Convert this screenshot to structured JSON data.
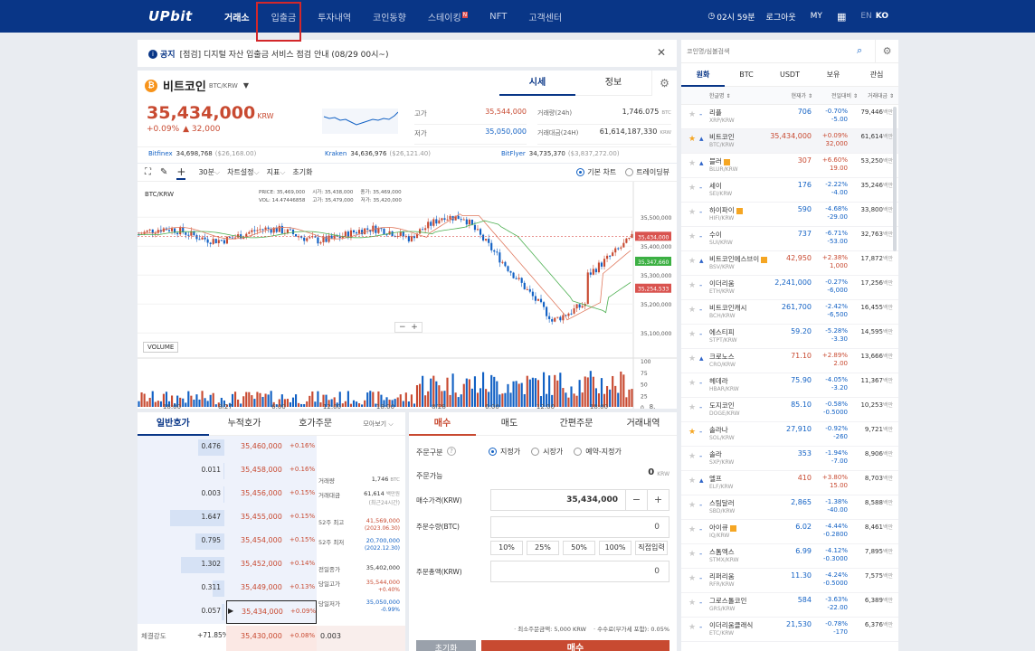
{
  "nav": {
    "logo": "UPbit",
    "menu": [
      {
        "label": "거래소",
        "active": true
      },
      {
        "label": "입출금",
        "active": false
      },
      {
        "label": "투자내역",
        "active": false
      },
      {
        "label": "코인동향",
        "active": false
      },
      {
        "label": "스테이킹",
        "active": false,
        "badge": "N"
      },
      {
        "label": "NFT",
        "active": false
      },
      {
        "label": "고객센터",
        "active": false
      }
    ],
    "timer": "02시 59분",
    "logout": "로그아웃",
    "my": "MY",
    "lang_en": "EN",
    "lang_ko": "KO"
  },
  "notice": {
    "tag": "공지",
    "text": "[점검] 디지털 자산 입출금 서비스 점검 안내 (08/29 00시~)"
  },
  "coin": {
    "name": "비트코인",
    "pair": "BTC/KRW",
    "price": "35,434,000",
    "unit": "KRW",
    "change_pct": "+0.09%",
    "change_amt": "▲ 32,000",
    "tab_chart": "시세",
    "tab_info": "정보",
    "stats": [
      {
        "label": "고가",
        "value": "35,544,000",
        "cls": "up"
      },
      {
        "label": "저가",
        "value": "35,050,000",
        "cls": "dn"
      }
    ],
    "stats2": [
      {
        "label": "거래량(24h)",
        "value": "1,746.075",
        "unit": "BTC"
      },
      {
        "label": "거래대금(24H)",
        "value": "61,614,187,330",
        "unit": "KRW"
      }
    ],
    "exchanges": [
      {
        "name": "Bitfinex",
        "price": "34,698,768",
        "usd": "($26,168.00)"
      },
      {
        "name": "Kraken",
        "price": "34,636,976",
        "usd": "($26,121.40)"
      },
      {
        "name": "BitFlyer",
        "price": "34,735,370",
        "usd": "($3,837,272.00)"
      }
    ]
  },
  "chart_toolbar": {
    "interval": "30분",
    "settings": "차트설정",
    "indicators": "지표",
    "reset": "초기화",
    "basic": "기본 차트",
    "tv": "트레이딩뷰"
  },
  "chart_data": {
    "type": "candlestick",
    "title": "BTC/KRW",
    "legend": {
      "price_label": "PRICE:",
      "price": "35,469,000",
      "vol_label": "VOL:",
      "vol": "14.47446858",
      "open_label": "시가:",
      "open": "35,438,000",
      "high_label": "고가:",
      "high": "35,479,000",
      "close_label": "종가:",
      "close": "35,469,000",
      "low_label": "저가:",
      "low": "35,420,000"
    },
    "y_ticks": [
      "35,500,000",
      "35,400,000",
      "35,300,000",
      "35,200,000",
      "35,100,000"
    ],
    "price_tags": [
      {
        "value": "35,434,000",
        "color": "#d9534f"
      },
      {
        "value": "35,347,660",
        "color": "#3cb043"
      },
      {
        "value": "35,254,533",
        "color": "#d9534f"
      }
    ],
    "x_ticks": [
      "18:00",
      "8/27",
      "6:00",
      "12:00",
      "18:00",
      "8/28",
      "6:00",
      "12:00",
      "18:00",
      "8."
    ],
    "volume_label": "VOLUME",
    "volume_ticks": [
      "100",
      "75",
      "50",
      "25",
      "0"
    ]
  },
  "orderbook": {
    "tabs": [
      "일반호가",
      "누적호가",
      "호가주문"
    ],
    "view": "모아보기",
    "rows": [
      {
        "qty": "0.476",
        "price": "35,460,000",
        "pct": "+0.16%",
        "bar": 0.3
      },
      {
        "qty": "0.011",
        "price": "35,458,000",
        "pct": "+0.16%",
        "bar": 0.01
      },
      {
        "qty": "0.003",
        "price": "35,456,000",
        "pct": "+0.15%",
        "bar": 0.01
      },
      {
        "qty": "1.647",
        "price": "35,455,000",
        "pct": "+0.15%",
        "bar": 0.62
      },
      {
        "qty": "0.795",
        "price": "35,454,000",
        "pct": "+0.15%",
        "bar": 0.33
      },
      {
        "qty": "1.302",
        "price": "35,452,000",
        "pct": "+0.14%",
        "bar": 0.5
      },
      {
        "qty": "0.311",
        "price": "35,449,000",
        "pct": "+0.13%",
        "bar": 0.14
      },
      {
        "qty": "0.057",
        "price": "35,434,000",
        "pct": "+0.09%",
        "bar": 0.03
      }
    ],
    "info": [
      {
        "label": "거래량",
        "value": "1,746",
        "unit": "BTC"
      },
      {
        "label": "거래대금",
        "value": "61,614",
        "unit": "백만원",
        "sub": "(최근24시간)"
      },
      {
        "label": "52주 최고",
        "value": "41,569,000",
        "sub": "(2023.06.30)",
        "cls": "up"
      },
      {
        "label": "52주 최저",
        "value": "20,700,000",
        "sub": "(2022.12.30)",
        "cls": "dn"
      },
      {
        "label": "전일종가",
        "value": "35,402,000"
      },
      {
        "label": "당일고가",
        "value": "35,544,000",
        "sub": "+0.40%",
        "cls": "up"
      },
      {
        "label": "당일저가",
        "value": "35,050,000",
        "sub": "-0.99%",
        "cls": "dn"
      }
    ],
    "bottom": {
      "label": "체결강도",
      "value": "+71.85%",
      "price": "35,430,000",
      "pct": "+0.08%",
      "qty": "0.003"
    }
  },
  "order": {
    "tabs": [
      "매수",
      "매도",
      "간편주문",
      "거래내역"
    ],
    "type_label": "주문구분",
    "types": [
      "지정가",
      "시장가",
      "예약-지정가"
    ],
    "avail_label": "주문가능",
    "avail": "0",
    "avail_unit": "KRW",
    "price_label": "매수가격(KRW)",
    "price": "35,434,000",
    "qty_label": "주문수량(BTC)",
    "qty": "0",
    "pcts": [
      "10%",
      "25%",
      "50%",
      "100%",
      "직접입력"
    ],
    "total_label": "주문총액(KRW)",
    "total": "0",
    "min_note": "· 최소주문금액: 5,000 KRW",
    "fee_note": "· 수수료(부가세 포함): 0.05%",
    "reset": "초기화",
    "buy": "매수"
  },
  "sidebar": {
    "search_placeholder": "코인명/심볼검색",
    "tabs": [
      "원화",
      "BTC",
      "USDT",
      "보유",
      "관심"
    ],
    "headers": [
      "한글명",
      "현재가",
      "전일대비",
      "거래대금"
    ],
    "rows": [
      {
        "name": "리플",
        "sym": "XRP/KRW",
        "price": "706",
        "pct": "-0.70%",
        "amt": "-5.00",
        "vol": "79,446",
        "dir": "dn",
        "star": false
      },
      {
        "name": "비트코인",
        "sym": "BTC/KRW",
        "price": "35,434,000",
        "pct": "+0.09%",
        "amt": "32,000",
        "vol": "61,614",
        "dir": "up",
        "star": true,
        "sel": true
      },
      {
        "name": "블러",
        "sym": "BLUR/KRW",
        "price": "307",
        "pct": "+6.60%",
        "amt": "19.00",
        "vol": "53,250",
        "dir": "up",
        "star": false,
        "badge": true
      },
      {
        "name": "세이",
        "sym": "SEI/KRW",
        "price": "176",
        "pct": "-2.22%",
        "amt": "-4.00",
        "vol": "35,246",
        "dir": "dn",
        "star": false
      },
      {
        "name": "하이파이",
        "sym": "HIFI/KRW",
        "price": "590",
        "pct": "-4.68%",
        "amt": "-29.00",
        "vol": "33,800",
        "dir": "dn",
        "star": false,
        "badge": true
      },
      {
        "name": "수이",
        "sym": "SUI/KRW",
        "price": "737",
        "pct": "-6.71%",
        "amt": "-53.00",
        "vol": "32,763",
        "dir": "dn",
        "star": false
      },
      {
        "name": "비트코인에스브이",
        "sym": "BSV/KRW",
        "price": "42,950",
        "pct": "+2.38%",
        "amt": "1,000",
        "vol": "17,872",
        "dir": "up",
        "star": false,
        "badge": true
      },
      {
        "name": "이더리움",
        "sym": "ETH/KRW",
        "price": "2,241,000",
        "pct": "-0.27%",
        "amt": "-6,000",
        "vol": "17,256",
        "dir": "dn",
        "star": false
      },
      {
        "name": "비트코인캐시",
        "sym": "BCH/KRW",
        "price": "261,700",
        "pct": "-2.42%",
        "amt": "-6,500",
        "vol": "16,455",
        "dir": "dn",
        "star": false
      },
      {
        "name": "에스티피",
        "sym": "STPT/KRW",
        "price": "59.20",
        "pct": "-5.28%",
        "amt": "-3.30",
        "vol": "14,595",
        "dir": "dn",
        "star": false
      },
      {
        "name": "크로노스",
        "sym": "CRO/KRW",
        "price": "71.10",
        "pct": "+2.89%",
        "amt": "2.00",
        "vol": "13,666",
        "dir": "up",
        "star": false
      },
      {
        "name": "헤데라",
        "sym": "HBAR/KRW",
        "price": "75.90",
        "pct": "-4.05%",
        "amt": "-3.20",
        "vol": "11,367",
        "dir": "dn",
        "star": false
      },
      {
        "name": "도지코인",
        "sym": "DOGE/KRW",
        "price": "85.10",
        "pct": "-0.58%",
        "amt": "-0.5000",
        "vol": "10,253",
        "dir": "dn",
        "star": false
      },
      {
        "name": "솔라나",
        "sym": "SOL/KRW",
        "price": "27,910",
        "pct": "-0.92%",
        "amt": "-260",
        "vol": "9,721",
        "dir": "dn",
        "star": true
      },
      {
        "name": "솔라",
        "sym": "SXP/KRW",
        "price": "353",
        "pct": "-1.94%",
        "amt": "-7.00",
        "vol": "8,906",
        "dir": "dn",
        "star": false
      },
      {
        "name": "엘프",
        "sym": "ELF/KRW",
        "price": "410",
        "pct": "+3.80%",
        "amt": "15.00",
        "vol": "8,703",
        "dir": "up",
        "star": false
      },
      {
        "name": "스팀달러",
        "sym": "SBD/KRW",
        "price": "2,865",
        "pct": "-1.38%",
        "amt": "-40.00",
        "vol": "8,588",
        "dir": "dn",
        "star": false
      },
      {
        "name": "아이큐",
        "sym": "IQ/KRW",
        "price": "6.02",
        "pct": "-4.44%",
        "amt": "-0.2800",
        "vol": "8,461",
        "dir": "dn",
        "star": false,
        "badge": true
      },
      {
        "name": "스톰엑스",
        "sym": "STMX/KRW",
        "price": "6.99",
        "pct": "-4.12%",
        "amt": "-0.3000",
        "vol": "7,895",
        "dir": "dn",
        "star": false
      },
      {
        "name": "리퍼리움",
        "sym": "RFR/KRW",
        "price": "11.30",
        "pct": "-4.24%",
        "amt": "-0.5000",
        "vol": "7,575",
        "dir": "dn",
        "star": false
      },
      {
        "name": "그로스톨코인",
        "sym": "GRS/KRW",
        "price": "584",
        "pct": "-3.63%",
        "amt": "-22.00",
        "vol": "6,389",
        "dir": "dn",
        "star": false
      },
      {
        "name": "이더리움클래식",
        "sym": "ETC/KRW",
        "price": "21,530",
        "pct": "-0.78%",
        "amt": "-170",
        "vol": "6,376",
        "dir": "dn",
        "star": false
      }
    ],
    "unit": "백만"
  }
}
